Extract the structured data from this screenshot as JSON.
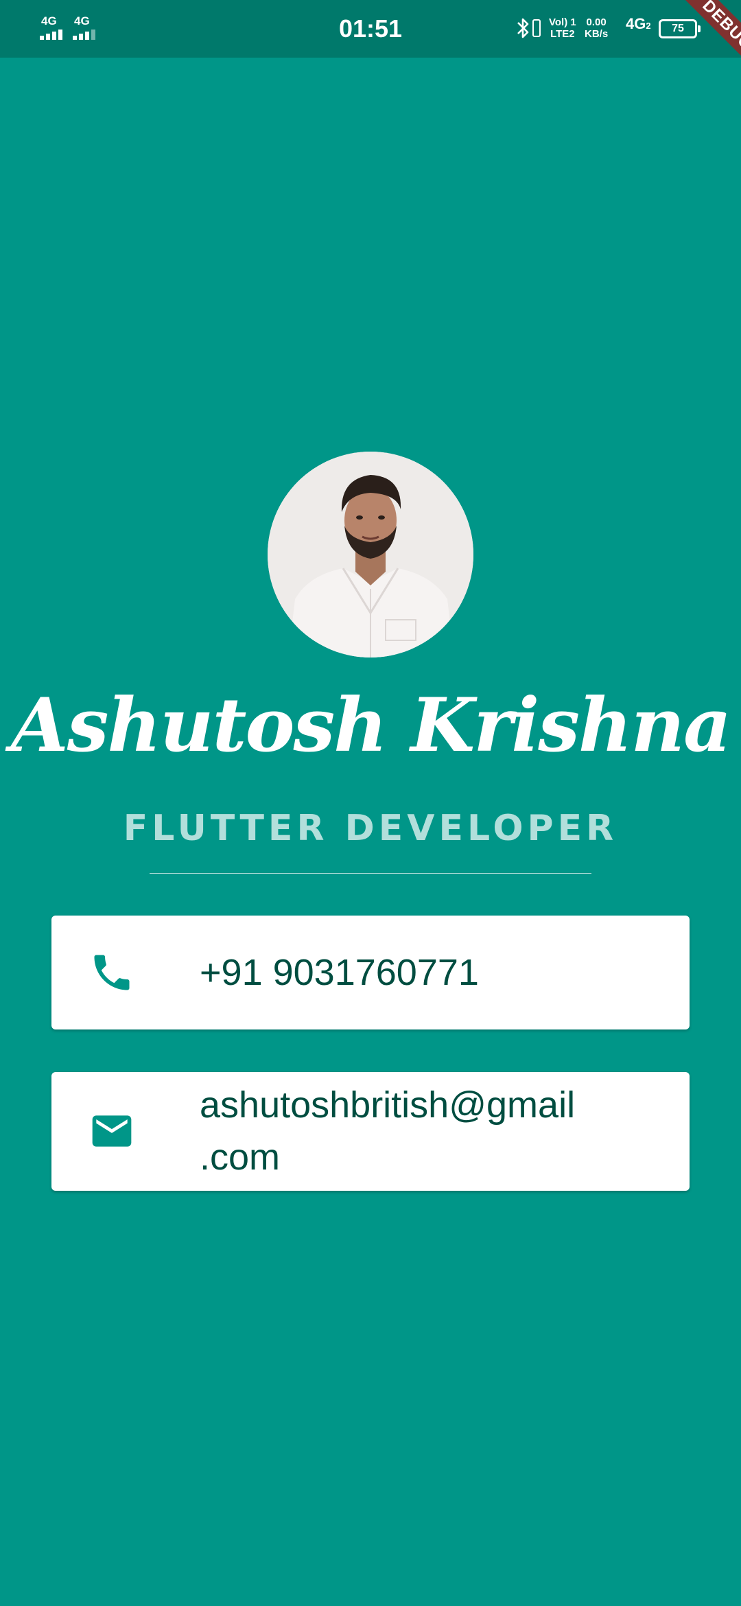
{
  "status_bar": {
    "network_1": "4G",
    "network_2": "4G",
    "time": "01:51",
    "volte_top": "Vol) 1",
    "volte_bottom": "LTE2",
    "speed_value": "0.00",
    "speed_unit": "KB/s",
    "network_3": "4G",
    "network_3_sub": "2",
    "battery": "75"
  },
  "debug_banner": "DEBUG",
  "profile": {
    "name": "Ashutosh Krishna",
    "title": "FLUTTER DEVELOPER"
  },
  "contacts": {
    "phone": "+91 9031760771",
    "email": "ashutoshbritish@gmail\n.com"
  },
  "colors": {
    "background": "#009688",
    "status_bar": "#00796b",
    "card": "#ffffff",
    "card_text": "#004d40",
    "icon": "#009688",
    "subtitle": "#b2dfdb"
  },
  "icons": {
    "phone": "phone-icon",
    "email": "mail-icon"
  }
}
